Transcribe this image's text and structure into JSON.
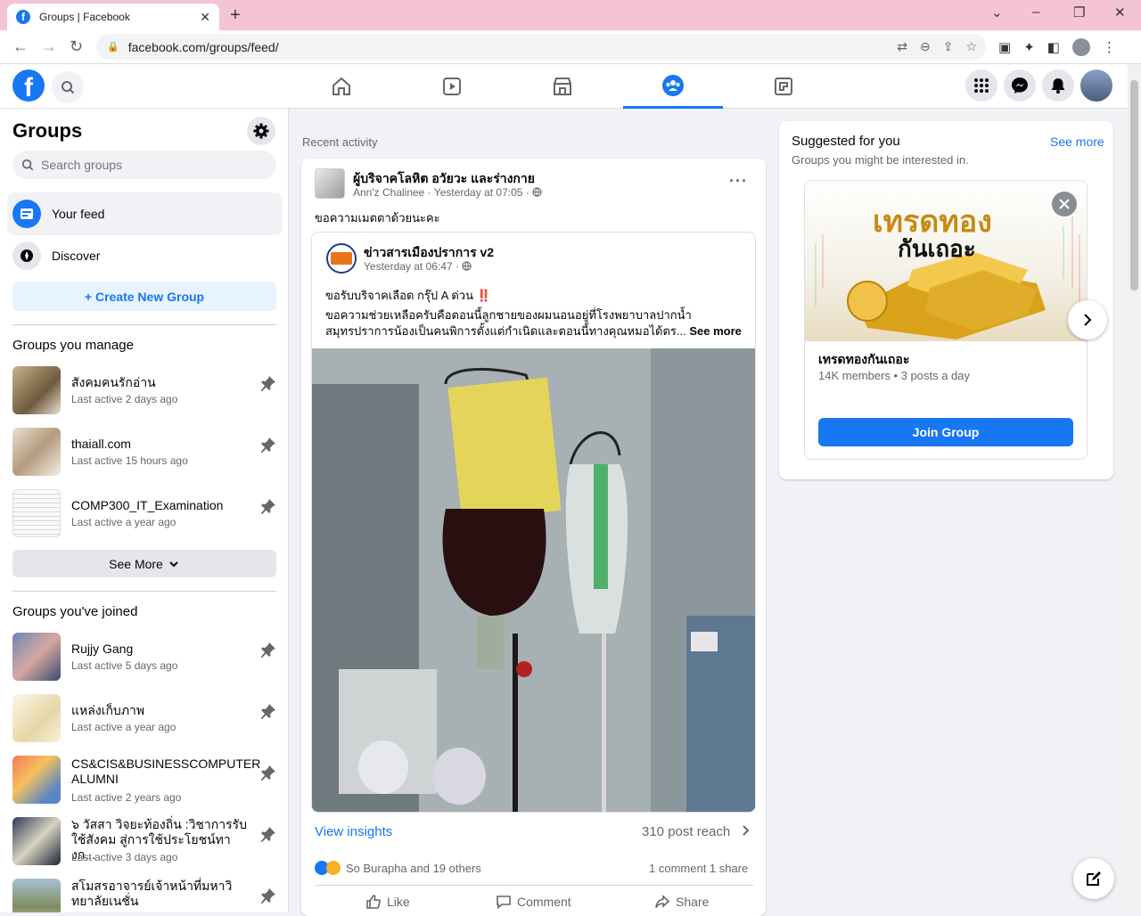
{
  "browser": {
    "tab_title": "Groups | Facebook",
    "url": "facebook.com/groups/feed/",
    "new_tab": "+",
    "tab_close": "✕"
  },
  "sidebar": {
    "title": "Groups",
    "search_placeholder": "Search groups",
    "nav": [
      {
        "label": "Your feed"
      },
      {
        "label": "Discover"
      }
    ],
    "create_label": "+ Create New Group",
    "manage_title": "Groups you manage",
    "managed_groups": [
      {
        "name": "สังคมคนรักอ่าน",
        "sub": "Last active 2 days ago"
      },
      {
        "name": "thaiall.com",
        "sub": "Last active 15 hours ago"
      },
      {
        "name": "COMP300_IT_Examination",
        "sub": "Last active a year ago"
      }
    ],
    "see_more_label": "See More",
    "joined_title": "Groups you've joined",
    "joined_groups": [
      {
        "name": "Rujjy Gang",
        "sub": "Last active 5 days ago"
      },
      {
        "name": "แหล่งเก็บภาพ",
        "sub": "Last active a year ago"
      },
      {
        "name": "CS&CIS&BUSINESSCOMPUTER ALUMNI",
        "sub": "Last active 2 years ago"
      },
      {
        "name": "๖ วัสสา วิจยะท้องถิ่น :วิชาการรับใช้สังคม สู่การใช้ประโยชน์ทางก...",
        "sub": "Last active 3 days ago"
      },
      {
        "name": "สโมสรอาจารย์เจ้าหน้าที่มหาวิทยาลัยเนชั่น",
        "sub": ""
      }
    ]
  },
  "feed": {
    "section_label": "Recent activity",
    "post": {
      "author": "ผู้บริจาคโลหิต อวัยวะ และร่างกาย",
      "meta": "Ann'z Chalinee · Yesterday at 07:05 ·",
      "text": "ขอความเมตตาด้วยนะคะ",
      "more_dots": "···",
      "shared": {
        "author": "ข่าวสารเมืองปราการ v2",
        "meta": "Yesterday at 06:47 ·",
        "line1": "ขอรับบริจาคเลือด กรุ๊ป A ด่วน",
        "line1_mark": "‼️",
        "body": "ขอความช่วยเหลือครับคือตอนนี้ลูกชายของผมนอนอยู่ที่โรงพยาบาลปากน้ำ สมุทรปราการน้องเป็นคนพิการตั้งแต่กำเนิดและตอนนี้ทางคุณหมอได้ตร...",
        "see_more": "See more"
      },
      "insights_label": "View insights",
      "reach_label": "310 post reach",
      "reactions_label": "So Burapha and 19 others",
      "counts_label": "1 comment  1 share",
      "actions": {
        "like": "Like",
        "comment": "Comment",
        "share": "Share"
      }
    }
  },
  "suggested": {
    "title": "Suggested for you",
    "see_more": "See more",
    "subtitle": "Groups you might be interested in.",
    "card": {
      "image_text_1": "เทรดทอง",
      "image_text_2": "กันเถอะ",
      "name": "เทรดทองกันเถอะ",
      "meta": "14K members • 3 posts a day",
      "join_label": "Join Group"
    }
  },
  "colors": {
    "brand": "#1877f2",
    "background": "#f0f2f5",
    "secondary_text": "#65676b"
  }
}
